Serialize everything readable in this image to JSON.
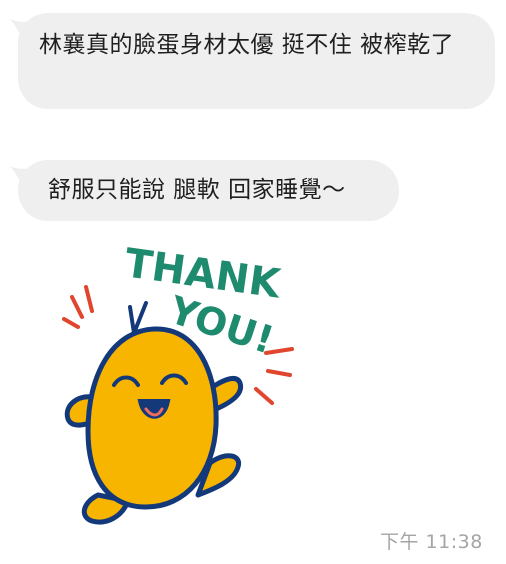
{
  "messages": [
    {
      "text": "林襄真的臉蛋身材太優 挺不住 被榨乾了"
    },
    {
      "text": "舒服只能說 腿軟 回家睡覺～"
    }
  ],
  "sticker": {
    "text_line1": "THANK",
    "text_line2": "YOU!",
    "character_color": "#f7b500",
    "outline_color": "#14397a",
    "text_color": "#1e8a6e",
    "accent_color": "#e0452e"
  },
  "timestamp": "下午 11:38",
  "colors": {
    "bubble_bg": "#efefef",
    "text": "#1f1f1f",
    "timestamp": "#a5a5a5"
  }
}
